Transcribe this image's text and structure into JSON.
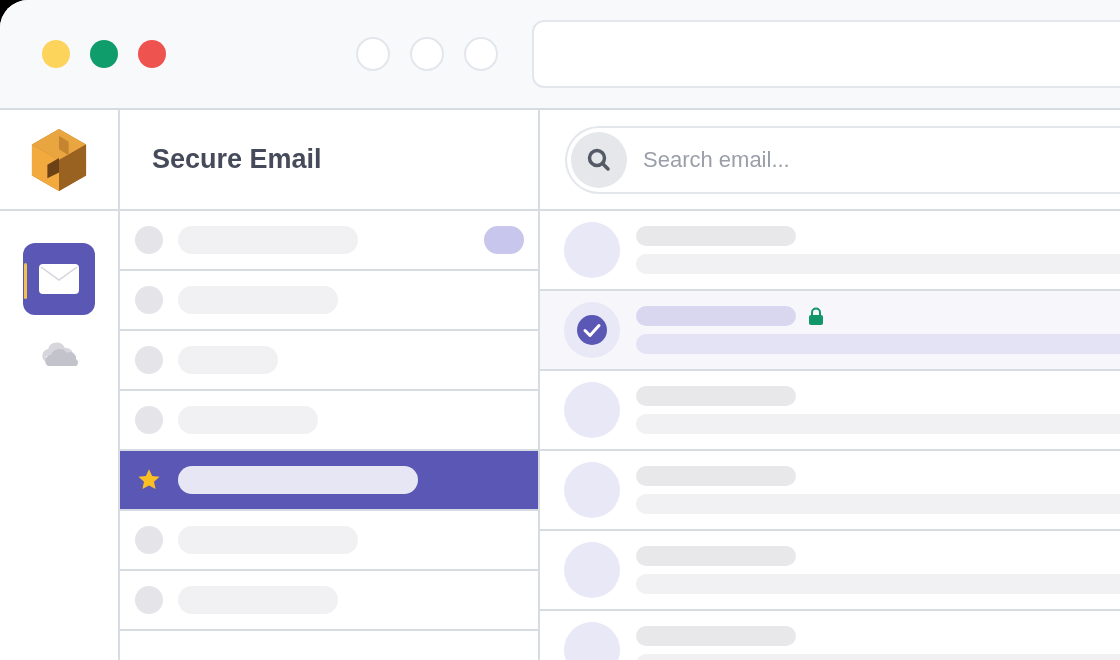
{
  "app": {
    "title": "Secure Email"
  },
  "rail": [
    {
      "kind": "mail",
      "selected": true
    },
    {
      "kind": "cloud",
      "selected": false
    }
  ],
  "search": {
    "placeholder": "Search email..."
  },
  "folders": [
    {
      "kind": "dot",
      "selected": false,
      "badge": true
    },
    {
      "kind": "dot",
      "selected": false,
      "badge": false
    },
    {
      "kind": "dot",
      "selected": false,
      "badge": false
    },
    {
      "kind": "dot",
      "selected": false,
      "badge": false
    },
    {
      "kind": "star",
      "selected": true,
      "badge": false
    },
    {
      "kind": "dot",
      "selected": false,
      "badge": false
    },
    {
      "kind": "dot",
      "selected": false,
      "badge": false
    }
  ],
  "emails": [
    {
      "selected": false,
      "encrypted": false
    },
    {
      "selected": true,
      "encrypted": true
    },
    {
      "selected": false,
      "encrypted": false
    },
    {
      "selected": false,
      "encrypted": false
    },
    {
      "selected": false,
      "encrypted": false
    },
    {
      "selected": false,
      "encrypted": false
    }
  ]
}
